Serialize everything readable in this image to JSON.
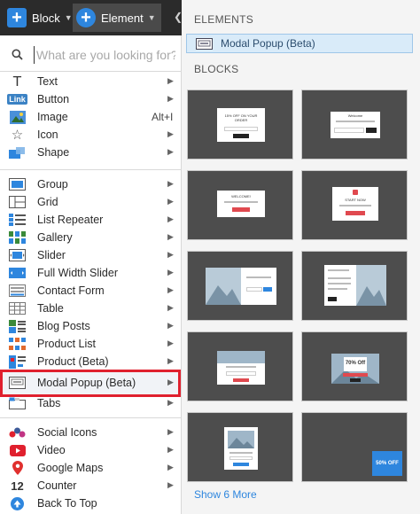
{
  "topbar": {
    "block_label": "Block",
    "element_label": "Element"
  },
  "search": {
    "placeholder": "What are you looking for?"
  },
  "menu": {
    "text": "Text",
    "button": "Button",
    "image": "Image",
    "image_shortcut": "Alt+I",
    "icon": "Icon",
    "shape": "Shape",
    "group": "Group",
    "grid": "Grid",
    "list_repeater": "List Repeater",
    "gallery": "Gallery",
    "slider": "Slider",
    "full_width_slider": "Full Width Slider",
    "contact_form": "Contact Form",
    "table": "Table",
    "blog_posts": "Blog Posts",
    "product_list": "Product List",
    "product_beta": "Product (Beta)",
    "modal_popup": "Modal Popup (Beta)",
    "tabs": "Tabs",
    "social_icons": "Social Icons",
    "video": "Video",
    "google_maps": "Google Maps",
    "counter": "Counter",
    "back_to_top": "Back To Top"
  },
  "icons": {
    "link_badge": "Link",
    "counter_badge": "12"
  },
  "panel": {
    "elements_title": "ELEMENTS",
    "element_item": "Modal Popup (Beta)",
    "blocks_title": "BLOCKS",
    "show_more": "Show 6 More"
  },
  "tiles": {
    "t1_heading": "15% OFF ON YOUR ORDER",
    "t2_heading": "Welcome",
    "t3_heading": "WELCOME!",
    "t4_heading": "START NOW",
    "t7_heading": "70% Off",
    "t10_badge": "50% OFF"
  },
  "colors": {
    "accent": "#2e86de",
    "highlight_border": "#e0202e",
    "tile_bg": "#4d4d4d",
    "topbar_bg": "#2b2b2b"
  }
}
